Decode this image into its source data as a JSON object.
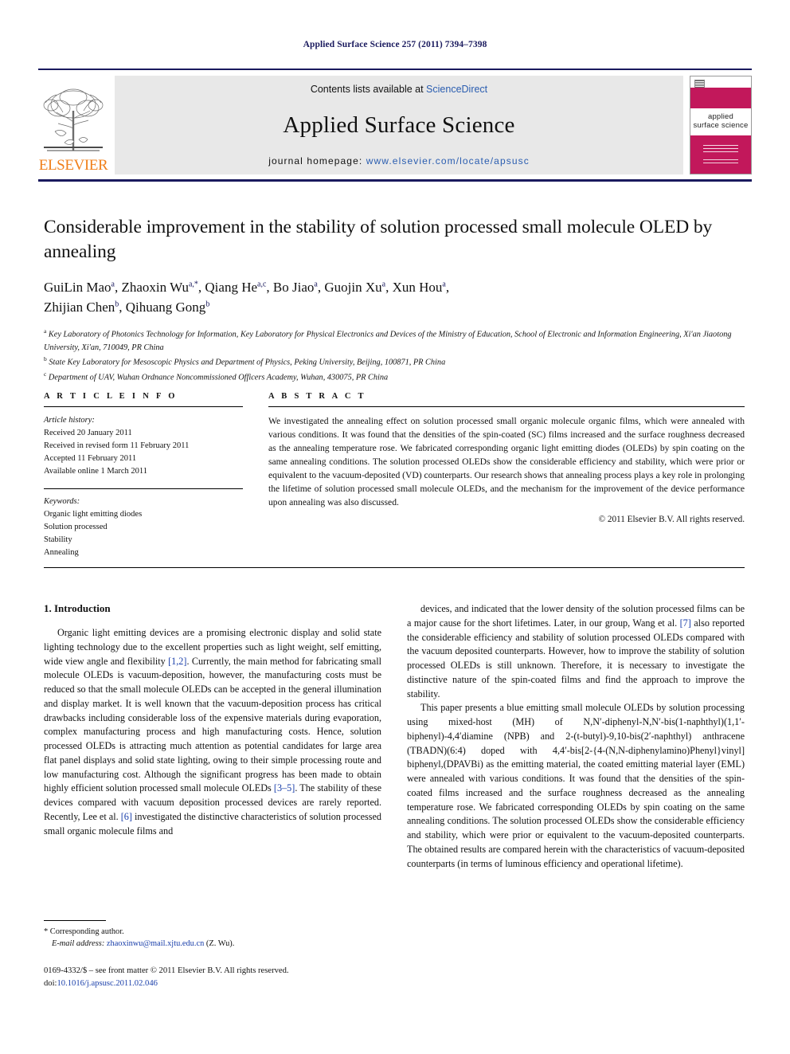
{
  "running_head": "Applied Surface Science 257 (2011) 7394–7398",
  "masthead": {
    "contents_prefix": "Contents lists available at ",
    "sciencedirect": "ScienceDirect",
    "journal_name": "Applied Surface Science",
    "homepage_prefix": "journal homepage:",
    "homepage_url": "www.elsevier.com/locate/apsusc",
    "publisher": "ELSEVIER",
    "cover": {
      "title_line1": "applied",
      "title_line2": "surface science"
    },
    "accent_navy": "#1a1a5e",
    "accent_orange": "#f07f1a",
    "cover_crimson": "#c2185b",
    "link_blue": "#2a5db0"
  },
  "article": {
    "title": "Considerable improvement in the stability of solution processed small molecule OLED by annealing",
    "authors_line1": "GuiLin Mao",
    "authors_html_line1": "GuiLin Mao<sup>a</sup>, Zhaoxin Wu<sup>a,*</sup>, Qiang He<sup>a,c</sup>, Bo Jiao<sup>a</sup>, Guojin Xu<sup>a</sup>, Xun Hou<sup>a</sup>,",
    "authors_html_line2": "Zhijian Chen<sup>b</sup>, Qihuang Gong<sup>b</sup>",
    "affiliations": [
      "Key Laboratory of Photonics Technology for Information, Key Laboratory for Physical Electronics and Devices of the Ministry of Education, School of Electronic and Information Engineering, Xi'an Jiaotong University, Xi'an, 710049, PR China",
      "State Key Laboratory for Mesoscopic Physics and Department of Physics, Peking University, Beijing, 100871, PR China",
      "Department of UAV, Wuhan Ordnance Noncommissioned Officers Academy, Wuhan, 430075, PR China"
    ]
  },
  "article_info": {
    "heading": "A R T I C L E  I N F O",
    "history_label": "Article history:",
    "history": [
      "Received 20 January 2011",
      "Received in revised form 11 February 2011",
      "Accepted 11 February 2011",
      "Available online 1 March 2011"
    ],
    "keywords_label": "Keywords:",
    "keywords": [
      "Organic light emitting diodes",
      "Solution processed",
      "Stability",
      "Annealing"
    ]
  },
  "abstract": {
    "heading": "A B S T R A C T",
    "text": "We investigated the annealing effect on solution processed small organic molecule organic films, which were annealed with various conditions. It was found that the densities of the spin-coated (SC) films increased and the surface roughness decreased as the annealing temperature rose. We fabricated corresponding organic light emitting diodes (OLEDs) by spin coating on the same annealing conditions. The solution processed OLEDs show the considerable efficiency and stability, which were prior or equivalent to the vacuum-deposited (VD) counterparts. Our research shows that annealing process plays a key role in prolonging the lifetime of solution processed small molecule OLEDs, and the mechanism for the improvement of the device performance upon annealing was also discussed.",
    "copyright": "© 2011 Elsevier B.V. All rights reserved."
  },
  "introduction": {
    "section_title": "1. Introduction",
    "para1_a": "Organic light emitting devices are a promising electronic display and solid state lighting technology due to the excellent properties such as light weight, self emitting, wide view angle and flexibility ",
    "para1_ref1": "[1,2]",
    "para1_b": ". Currently, the main method for fabricating small molecule OLEDs is vacuum-deposition, however, the manufacturing costs must be reduced so that the small molecule OLEDs can be accepted in the general illumination and display market. It is well known that the vacuum-deposition process has critical drawbacks including considerable loss of the expensive materials during evaporation, complex manufacturing process and high manufacturing costs. Hence, solution processed OLEDs is attracting much attention as potential candidates for large area flat panel displays and solid state lighting, owing to their simple processing route and low manufacturing cost. Although the significant progress has been made to obtain highly efficient solution processed small molecule OLEDs ",
    "para1_ref2": "[3–5]",
    "para1_c": ". The stability of these devices compared with vacuum deposition processed devices are rarely reported. Recently, Lee et al. ",
    "para1_ref3": "[6]",
    "para1_d": " investigated the distinctive characteristics of solution processed small organic molecule films and",
    "para2_a": "devices, and indicated that the lower density of the solution processed films can be a major cause for the short lifetimes. Later, in our group, Wang et al. ",
    "para2_ref1": "[7]",
    "para2_b": " also reported the considerable efficiency and stability of solution processed OLEDs compared with the vacuum deposited counterparts. However, how to improve the stability of solution processed OLEDs is still unknown. Therefore, it is necessary to investigate the distinctive nature of the spin-coated films and find the approach to improve the stability.",
    "para3": "This paper presents a blue emitting small molecule OLEDs by solution processing using mixed-host (MH) of N,N′-diphenyl-N,N′-bis(1-naphthyl)(1,1′-biphenyl)-4,4′diamine (NPB) and 2-(t-butyl)-9,10-bis(2′-naphthyl) anthracene (TBADN)(6:4) doped with 4,4′-bis[2-{4-(N,N-diphenylamino)Phenyl}vinyl] biphenyl,(DPAVBi) as the emitting material, the coated emitting material layer (EML) were annealed with various conditions. It was found that the densities of the spin-coated films increased and the surface roughness decreased as the annealing temperature rose. We fabricated corresponding OLEDs by spin coating on the same annealing conditions. The solution processed OLEDs show the considerable efficiency and stability, which were prior or equivalent to the vacuum-deposited counterparts. The obtained results are compared herein with the characteristics of vacuum-deposited counterparts (in terms of luminous efficiency and operational lifetime)."
  },
  "footnote": {
    "corresponding": "* Corresponding author.",
    "email_label": "E-mail address:",
    "email": "zhaoxinwu@mail.xjtu.edu.cn",
    "email_suffix": " (Z. Wu)."
  },
  "page_footer": {
    "line1": "0169-4332/$ – see front matter © 2011 Elsevier B.V. All rights reserved.",
    "doi_label": "doi:",
    "doi": "10.1016/j.apsusc.2011.02.046"
  }
}
